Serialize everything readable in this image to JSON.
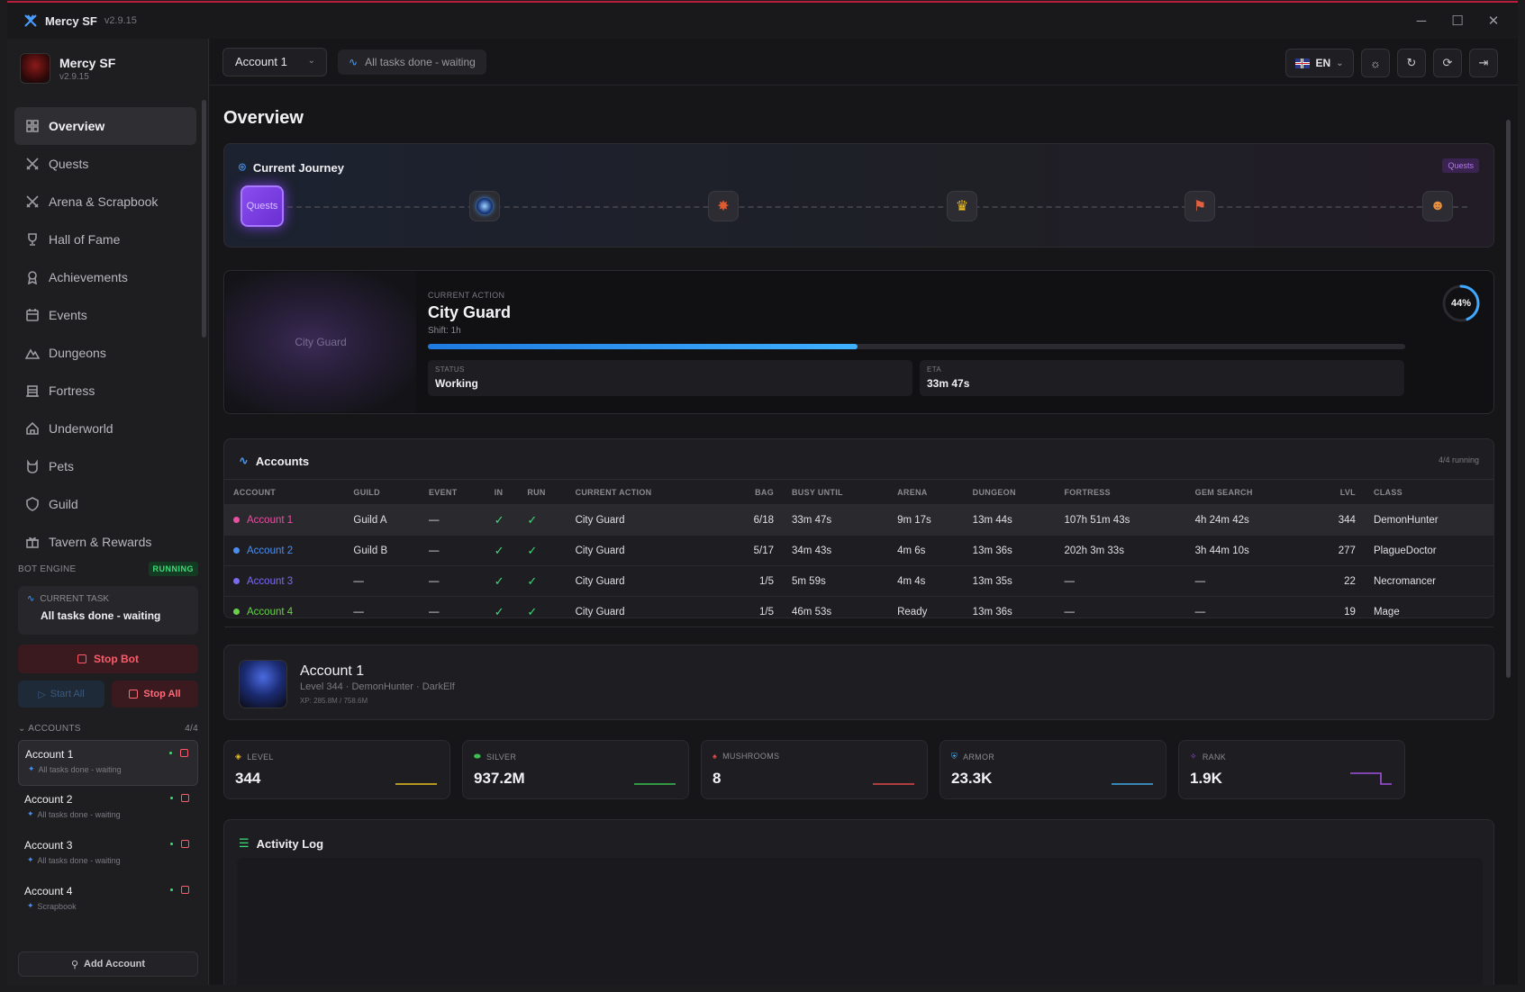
{
  "titlebar": {
    "app": "Mercy SF",
    "version": "v2.9.15"
  },
  "sidebar": {
    "brand_name": "Mercy SF",
    "brand_version": "v2.9.15",
    "nav": [
      {
        "label": "Overview",
        "icon": "grid-icon",
        "active": true
      },
      {
        "label": "Quests",
        "icon": "swords-icon"
      },
      {
        "label": "Arena & Scrapbook",
        "icon": "swords-icon"
      },
      {
        "label": "Hall of Fame",
        "icon": "trophy-icon"
      },
      {
        "label": "Achievements",
        "icon": "medal-icon"
      },
      {
        "label": "Events",
        "icon": "calendar-icon"
      },
      {
        "label": "Dungeons",
        "icon": "mountain-icon"
      },
      {
        "label": "Fortress",
        "icon": "building-icon"
      },
      {
        "label": "Underworld",
        "icon": "home-icon"
      },
      {
        "label": "Pets",
        "icon": "cat-icon"
      },
      {
        "label": "Guild",
        "icon": "shield-icon"
      },
      {
        "label": "Tavern & Rewards",
        "icon": "gift-icon"
      }
    ],
    "engine_label": "BOT ENGINE",
    "engine_status": "RUNNING",
    "current_task_label": "CURRENT TASK",
    "current_task_value": "All tasks done - waiting",
    "stop_bot": "Stop Bot",
    "start_all": "Start All",
    "stop_all": "Stop All",
    "accounts_label": "ACCOUNTS",
    "accounts_count": "4/4",
    "accounts": [
      {
        "name": "Account 1",
        "status": "All tasks done - waiting"
      },
      {
        "name": "Account 2",
        "status": "All tasks done - waiting"
      },
      {
        "name": "Account 3",
        "status": "All tasks done - waiting"
      },
      {
        "name": "Account 4",
        "status": "Scrapbook"
      }
    ],
    "add_account": "Add Account"
  },
  "topbar": {
    "account_select": "Account 1",
    "status": "All tasks done - waiting",
    "lang": "EN"
  },
  "page_title": "Overview",
  "journey": {
    "title": "Current Journey",
    "tag": "Quests",
    "first_node": "Quests"
  },
  "action": {
    "art_label": "City Guard",
    "label": "CURRENT ACTION",
    "name": "City Guard",
    "shift": "Shift: 1h",
    "progress_pct": 44,
    "progress_text": "44%",
    "status_label": "STATUS",
    "status_value": "Working",
    "eta_label": "ETA",
    "eta_value": "33m 47s"
  },
  "accounts_table": {
    "title": "Accounts",
    "running": "4/4 running",
    "headers": [
      "ACCOUNT",
      "GUILD",
      "EVENT",
      "IN",
      "RUN",
      "CURRENT ACTION",
      "BAG",
      "BUSY UNTIL",
      "ARENA",
      "DUNGEON",
      "FORTRESS",
      "GEM SEARCH",
      "LVL",
      "CLASS"
    ],
    "rows": [
      {
        "color": "#e84fa0",
        "account": "Account 1",
        "guild": "Guild A",
        "event": "—",
        "in": "✓",
        "run": "✓",
        "action": "City Guard",
        "bag": "6/18",
        "busy": "33m 47s",
        "arena": "9m 17s",
        "dungeon": "13m 44s",
        "fortress": "107h 51m 43s",
        "gem": "4h 24m 42s",
        "lvl": "344",
        "class": "DemonHunter"
      },
      {
        "color": "#4a8ef0",
        "account": "Account 2",
        "guild": "Guild B",
        "event": "—",
        "in": "✓",
        "run": "✓",
        "action": "City Guard",
        "bag": "5/17",
        "busy": "34m 43s",
        "arena": "4m 6s",
        "dungeon": "13m 36s",
        "fortress": "202h 3m 33s",
        "gem": "3h 44m 10s",
        "lvl": "277",
        "class": "PlagueDoctor"
      },
      {
        "color": "#7a6af0",
        "account": "Account 3",
        "guild": "—",
        "event": "—",
        "in": "✓",
        "run": "✓",
        "action": "City Guard",
        "bag": "1/5",
        "busy": "5m 59s",
        "arena": "4m 4s",
        "dungeon": "13m 35s",
        "fortress": "—",
        "gem": "—",
        "lvl": "22",
        "class": "Necromancer"
      },
      {
        "color": "#6ad04a",
        "account": "Account 4",
        "guild": "—",
        "event": "—",
        "in": "✓",
        "run": "✓",
        "action": "City Guard",
        "bag": "1/5",
        "busy": "46m 53s",
        "arena": "Ready",
        "dungeon": "13m 36s",
        "fortress": "—",
        "gem": "—",
        "lvl": "19",
        "class": "Mage"
      }
    ]
  },
  "profile": {
    "name": "Account 1",
    "sub": "Level 344 · DemonHunter · DarkElf",
    "xp": "XP: 285.8M / 758.6M"
  },
  "stats": [
    {
      "label": "LEVEL",
      "value": "344",
      "color": "#e8c020",
      "icon": "level-icon"
    },
    {
      "label": "SILVER",
      "value": "937.2M",
      "color": "#3ac050",
      "icon": "coin-icon"
    },
    {
      "label": "MUSHROOMS",
      "value": "8",
      "color": "#e04848",
      "icon": "mushroom-icon"
    },
    {
      "label": "ARMOR",
      "value": "23.3K",
      "color": "#40a8e8",
      "icon": "armor-icon"
    },
    {
      "label": "RANK",
      "value": "1.9K",
      "color": "#a050e0",
      "icon": "rank-icon"
    }
  ],
  "activity": {
    "title": "Activity Log"
  }
}
